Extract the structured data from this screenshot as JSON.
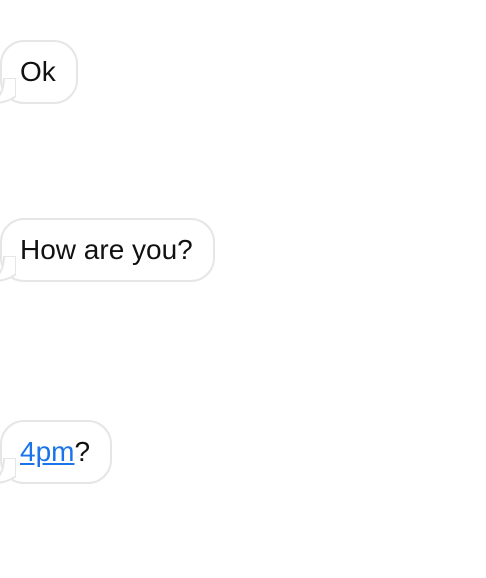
{
  "messages": [
    {
      "text": "Ok"
    },
    {
      "text": "How are you?"
    },
    {
      "link_text": "4pm",
      "suffix": "?"
    }
  ],
  "colors": {
    "bubble_border": "#e6e6e6",
    "bubble_fill": "#ffffff",
    "text": "#111111",
    "link": "#1a73e8"
  }
}
